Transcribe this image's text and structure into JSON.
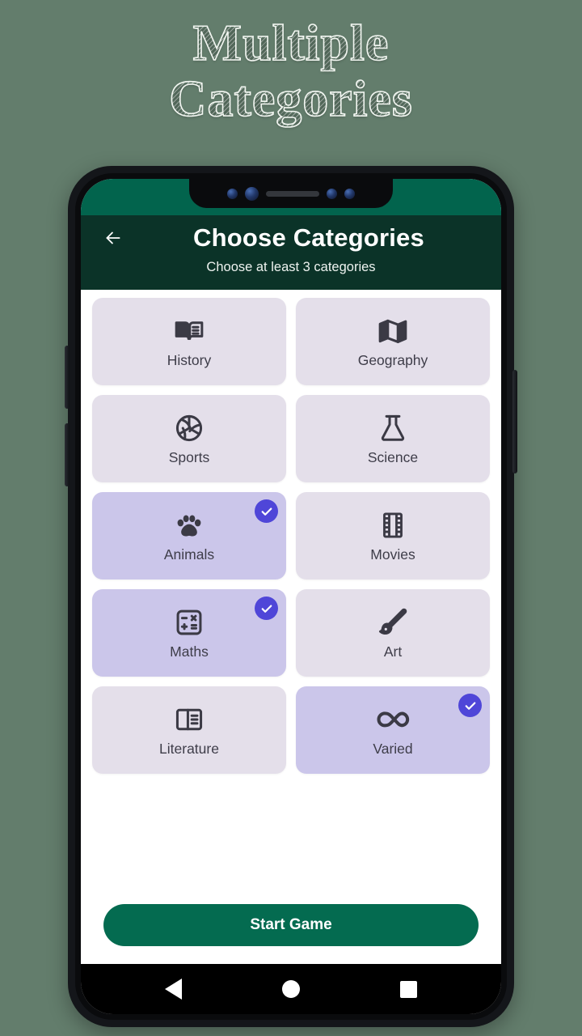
{
  "promo": {
    "line1": "Multiple",
    "line2": "Categories"
  },
  "colors": {
    "page_background": "#637d6c",
    "status_bar": "#02644d",
    "app_bar": "#0b3328",
    "card_unselected": "#e4dfea",
    "card_selected": "#cbc6ea",
    "check_badge": "#4f46d8",
    "start_button": "#046b50",
    "icon": "#3b3a45"
  },
  "app_bar": {
    "back_icon": "arrow-left-icon",
    "title": "Choose Categories",
    "subtitle": "Choose at least 3 categories"
  },
  "categories": [
    {
      "label": "History",
      "icon": "open-book-icon",
      "selected": false
    },
    {
      "label": "Geography",
      "icon": "folded-map-icon",
      "selected": false
    },
    {
      "label": "Sports",
      "icon": "volleyball-icon",
      "selected": false
    },
    {
      "label": "Science",
      "icon": "flask-icon",
      "selected": false
    },
    {
      "label": "Animals",
      "icon": "paw-print-icon",
      "selected": true
    },
    {
      "label": "Movies",
      "icon": "film-strip-icon",
      "selected": false
    },
    {
      "label": "Maths",
      "icon": "calculator-icon",
      "selected": true
    },
    {
      "label": "Art",
      "icon": "paintbrush-icon",
      "selected": false
    },
    {
      "label": "Literature",
      "icon": "article-icon",
      "selected": false
    },
    {
      "label": "Varied",
      "icon": "infinity-icon",
      "selected": true
    }
  ],
  "selected_count": 3,
  "start_button": {
    "label": "Start Game"
  },
  "nav_bar": {
    "back": "triangle-back-icon",
    "home": "circle-home-icon",
    "recents": "square-recents-icon"
  },
  "notch": {
    "sensors": 4,
    "speaker": "speaker-grille"
  }
}
